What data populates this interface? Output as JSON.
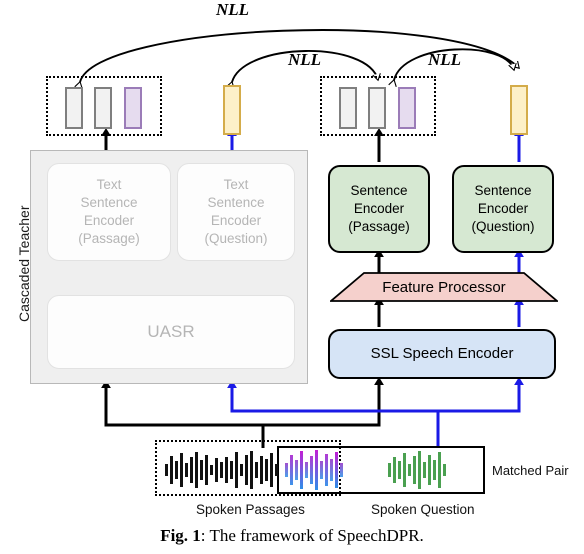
{
  "figure": {
    "caption_number": "Fig. 1",
    "caption_text": ": The framework of SpeechDPR."
  },
  "losses": [
    {
      "id": "nll-top",
      "label": "NLL"
    },
    {
      "id": "nll-middle",
      "label": "NLL"
    },
    {
      "id": "nll-right",
      "label": "NLL"
    }
  ],
  "teacher": {
    "panel_label": "Cascaded Teacher",
    "text_sentence_encoder_passage": {
      "line1": "Text",
      "line2": "Sentence",
      "line3": "Encoder",
      "line4": "(Passage)"
    },
    "text_sentence_encoder_question": {
      "line1": "Text",
      "line2": "Sentence",
      "line3": "Encoder",
      "line4": "(Question)"
    },
    "uasr_label": "UASR"
  },
  "student": {
    "sentence_encoder_passage": {
      "line1": "Sentence",
      "line2": "Encoder",
      "line3": "(Passage)"
    },
    "sentence_encoder_question": {
      "line1": "Sentence",
      "line2": "Encoder",
      "line3": "(Question)"
    },
    "feature_processor_label": "Feature Processor",
    "ssl_speech_encoder_label": "SSL Speech Encoder"
  },
  "audio": {
    "spoken_passages_label": "Spoken Passages",
    "spoken_question_label": "Spoken Question",
    "matched_pair_label": "Matched Pair"
  },
  "colors": {
    "teacher_panel_bg": "#efefef",
    "faded_text": "#b5b5b5",
    "sentence_encoder_green": "#d6e8d2",
    "feature_processor_pink": "#f5d0cc",
    "ssl_encoder_blue": "#d6e4f6",
    "embedding_gray": "#f2f2f2",
    "embedding_purple": "#e6dcef",
    "embedding_yellow": "#fdf0c8",
    "passage_flow_arrow": "#000000",
    "question_flow_arrow": "#1a1ae6",
    "waveform_black": "#111111",
    "waveform_green": "#4aa050",
    "waveform_magenta": "#c21fd4",
    "waveform_blue": "#2d8fe8"
  }
}
